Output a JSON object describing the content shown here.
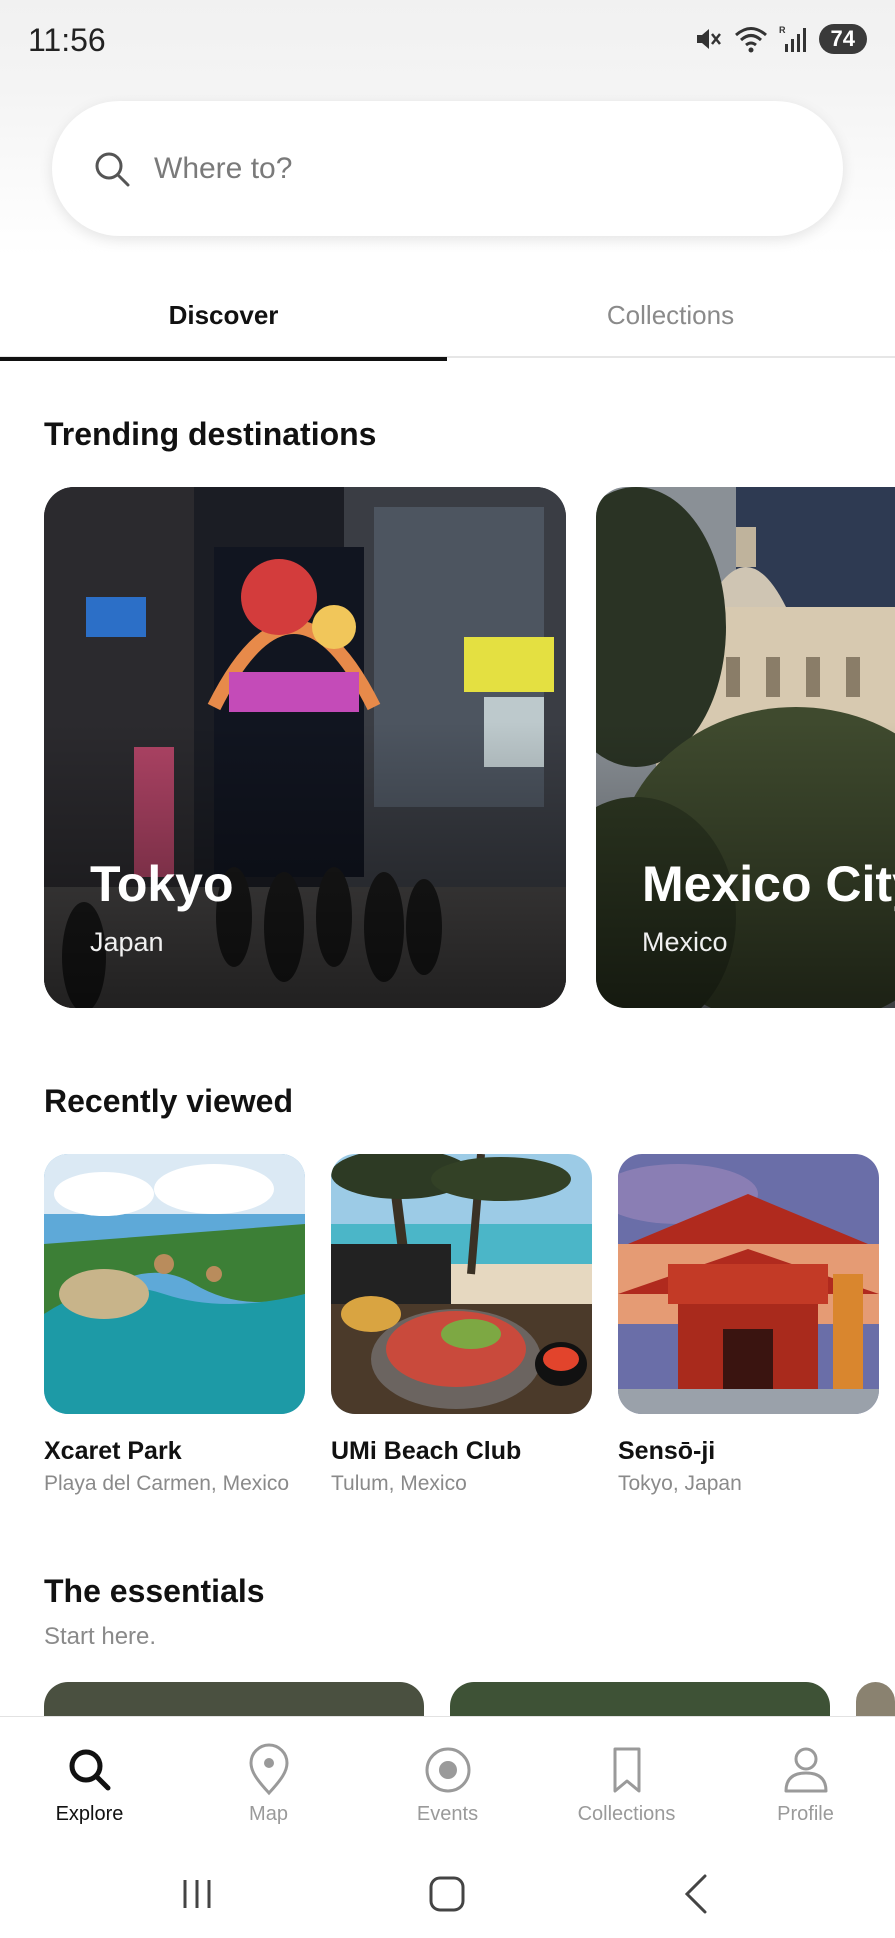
{
  "status_bar": {
    "time": "11:56",
    "battery": "74",
    "network_label": "R"
  },
  "search": {
    "placeholder": "Where to?"
  },
  "tabs": [
    {
      "label": "Discover",
      "active": true
    },
    {
      "label": "Collections",
      "active": false
    }
  ],
  "trending": {
    "title": "Trending destinations",
    "cards": [
      {
        "name": "Tokyo",
        "country": "Japan"
      },
      {
        "name": "Mexico City",
        "country": "Mexico"
      }
    ]
  },
  "recent": {
    "title": "Recently viewed",
    "items": [
      {
        "name": "Xcaret Park",
        "location": "Playa del Carmen, Mexico"
      },
      {
        "name": "UMi Beach Club",
        "location": "Tulum, Mexico"
      },
      {
        "name": "Sensō-ji",
        "location": "Tokyo, Japan"
      }
    ]
  },
  "essentials": {
    "title": "The essentials",
    "subtitle": "Start here."
  },
  "bottom_nav": [
    {
      "label": "Explore",
      "icon": "search-icon",
      "active": true
    },
    {
      "label": "Map",
      "icon": "map-pin-icon",
      "active": false
    },
    {
      "label": "Events",
      "icon": "events-icon",
      "active": false
    },
    {
      "label": "Collections",
      "icon": "bookmark-icon",
      "active": false
    },
    {
      "label": "Profile",
      "icon": "person-icon",
      "active": false
    }
  ],
  "colors": {
    "text": "#111111",
    "muted": "#8a8a8a",
    "divider": "#e6e6e6",
    "active_tab_underline": "#111111"
  }
}
